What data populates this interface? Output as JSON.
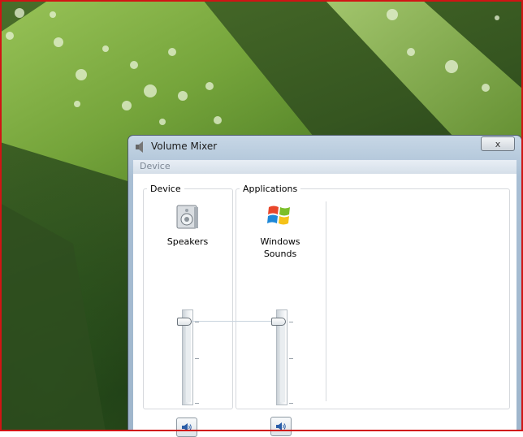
{
  "window": {
    "title": "Volume Mixer",
    "close_glyph": "x",
    "menu": [
      "Device"
    ]
  },
  "device_group": {
    "legend": "Device",
    "device_name": "Speakers",
    "icon": "speaker-icon",
    "volume_fraction": 0.87,
    "mute_icon": "speaker-volume-icon"
  },
  "applications_group": {
    "legend": "Applications",
    "apps": [
      {
        "name": "Windows Sounds",
        "icon": "windows-logo-icon",
        "volume_fraction": 0.87,
        "mute_icon": "speaker-volume-icon"
      }
    ]
  },
  "colors": {
    "frame_border": "#d11414",
    "window_chrome": "#a9bfd4"
  }
}
